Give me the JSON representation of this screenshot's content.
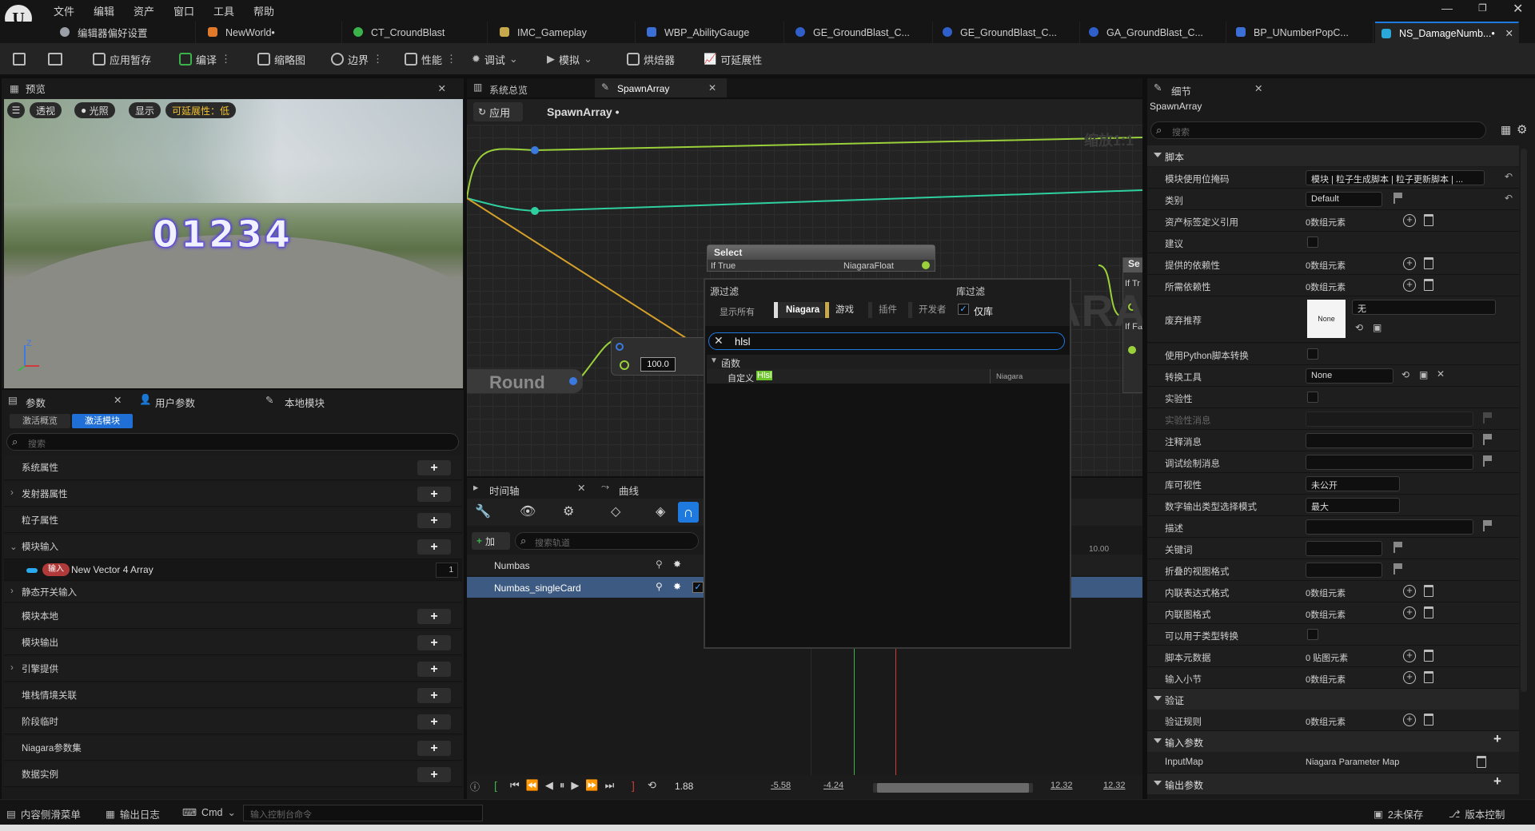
{
  "menu": [
    "文件",
    "编辑",
    "资产",
    "窗口",
    "工具",
    "帮助"
  ],
  "tabs": [
    {
      "label": "编辑器偏好设置",
      "color": "#9aa0a6"
    },
    {
      "label": "NewWorld•",
      "color": "#e07a2a"
    },
    {
      "label": "CT_CroundBlast",
      "color": "#3bb34a"
    },
    {
      "label": "IMC_Gameplay",
      "color": "#c7a84a"
    },
    {
      "label": "WBP_AbilityGauge",
      "color": "#3b6fd6"
    },
    {
      "label": "GE_GroundBlast_C...",
      "color": "#2f5fc9"
    },
    {
      "label": "GE_GroundBlast_C...",
      "color": "#2f5fc9"
    },
    {
      "label": "GA_GroundBlast_C...",
      "color": "#2f5fc9"
    },
    {
      "label": "BP_UNumberPopC...",
      "color": "#3b6fd6"
    },
    {
      "label": "NS_DamageNumb...•",
      "color": "#2aa8d8"
    }
  ],
  "toolbar": {
    "apply_save": "应用暂存",
    "compile": "编译",
    "thumbnail": "缩略图",
    "bounds": "边界",
    "perf": "性能",
    "debug": "调试",
    "simulate": "模拟",
    "baker": "烘焙器",
    "scalability": "可延展性"
  },
  "preview": {
    "title": "预览",
    "perspective": "透视",
    "lit": "光照",
    "show": "显示",
    "scalability": "可延展性：低",
    "number": "01234",
    "axis_z": "Z"
  },
  "params": {
    "tabs": {
      "params": "参数",
      "user": "用户参数",
      "local": "本地模块"
    },
    "subtabs": {
      "overview": "激活概览",
      "active": "激活模块"
    },
    "search_placeholder": "搜索",
    "rows": [
      "系统属性",
      "发射器属性",
      "粒子属性",
      "模块输入",
      "静态开关输入",
      "模块本地",
      "模块输出",
      "引擎提供",
      "堆栈情境关联",
      "阶段临时",
      "Niagara参数集",
      "数据实例"
    ],
    "input_badge": "输入",
    "input_name": "New Vector 4 Array",
    "input_count": "1"
  },
  "graph": {
    "tabs": {
      "overview": "系统总览",
      "spawn": "SpawnArray"
    },
    "apply": "应用",
    "breadcrumb": "SpawnArray •",
    "zoom": "缩放1:1",
    "select_title": "Select",
    "if_true": "If True",
    "if_false": "If Fa",
    "float_label": "NiagaraFloat",
    "se_title": "Se",
    "if_tr": "If Tr",
    "round": "Round",
    "value": "100.0",
    "watermark": "ARA"
  },
  "timeline": {
    "tab": "时间轴",
    "curve": "曲线",
    "add": "加",
    "search_placeholder": "搜索轨道",
    "tracks": [
      "Numbas",
      "Numbas_singleCard"
    ],
    "time": "1.88",
    "start": "-5.58",
    "start2": "-4.24",
    "end": "12.32",
    "end2": "12.32",
    "tick": "10.00"
  },
  "popup": {
    "source_filter": "源过滤",
    "lib_filter": "库过滤",
    "show_all": "显示所有",
    "niagara": "Niagara",
    "game": "游戏",
    "plugin": "插件",
    "developer": "开发者",
    "lib_only": "仅库",
    "search_value": "hlsl",
    "category": "函数",
    "result_prefix": "自定义",
    "result_match": "Hlsl",
    "result_source": "Niagara"
  },
  "details": {
    "title": "细节",
    "subject": "SpawnArray",
    "search_placeholder": "搜索",
    "sections": {
      "script": "脚本",
      "validation": "验证",
      "input_params": "输入参数",
      "output_params": "输出参数"
    },
    "rows": [
      {
        "label": "模块使用位掩码",
        "type": "dropdown",
        "value": "模块 | 粒子生成脚本 | 粒子更新脚本 | ..."
      },
      {
        "label": "类别",
        "type": "input",
        "value": "Default"
      },
      {
        "label": "资产标签定义引用",
        "type": "array",
        "value": "0数组元素"
      },
      {
        "label": "建议",
        "type": "check"
      },
      {
        "label": "提供的依赖性",
        "type": "array",
        "value": "0数组元素"
      },
      {
        "label": "所需依赖性",
        "type": "array",
        "value": "0数组元素"
      },
      {
        "label": "废弃推荐",
        "type": "deprec",
        "value": "None",
        "sel": "无"
      },
      {
        "label": "使用Python脚本转换",
        "type": "check"
      },
      {
        "label": "转换工具",
        "type": "dropdown",
        "value": "None"
      },
      {
        "label": "实验性",
        "type": "check"
      },
      {
        "label": "实验性消息",
        "type": "disabled"
      },
      {
        "label": "注释消息",
        "type": "input"
      },
      {
        "label": "调试绘制消息",
        "type": "input"
      },
      {
        "label": "库可视性",
        "type": "dropdown",
        "value": "未公开"
      },
      {
        "label": "数字输出类型选择模式",
        "type": "dropdown",
        "value": "最大"
      },
      {
        "label": "描述",
        "type": "input"
      },
      {
        "label": "关键词",
        "type": "input"
      },
      {
        "label": "折叠的视图格式",
        "type": "input"
      },
      {
        "label": "内联表达式格式",
        "type": "array",
        "value": "0数组元素"
      },
      {
        "label": "内联图格式",
        "type": "array",
        "value": "0数组元素"
      },
      {
        "label": "可以用于类型转换",
        "type": "check"
      },
      {
        "label": "脚本元数据",
        "type": "array",
        "value": "0 贴图元素"
      },
      {
        "label": "输入小节",
        "type": "array",
        "value": "0数组元素"
      }
    ],
    "validation_rules_label": "验证规则",
    "validation_rules_value": "0数组元素",
    "inputmap_label": "InputMap",
    "inputmap_value": "Niagara Parameter Map"
  },
  "status": {
    "content_drawer": "内容侧滑菜单",
    "output_log": "输出日志",
    "cmd": "Cmd",
    "console_placeholder": "输入控制台命令",
    "unsaved": "2未保存",
    "source_control": "版本控制"
  }
}
